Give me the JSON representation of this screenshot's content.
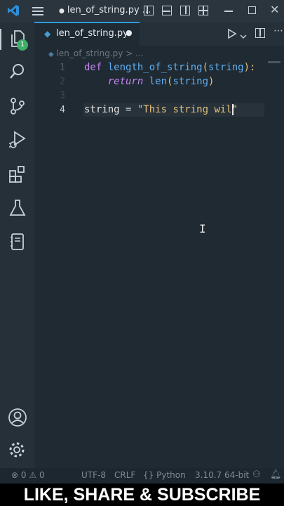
{
  "window": {
    "title": "len_of_string.py ...",
    "modified_indicator": "●"
  },
  "activity_bar": {
    "explorer_badge": "1",
    "items": [
      "explorer",
      "search",
      "source-control",
      "run-debug",
      "extensions",
      "testing",
      "notebook"
    ],
    "bottom_items": [
      "accounts",
      "manage"
    ]
  },
  "tab": {
    "label": "len_of_string.py",
    "dirty_dot": "●"
  },
  "breadcrumb": {
    "file": "len_of_string.py",
    "separator": ">",
    "more": "..."
  },
  "editor": {
    "lines": [
      {
        "number": "1",
        "tokens": {
          "def": "def",
          "name": "length_of_string",
          "open": "(",
          "param": "string",
          "close": "):"
        }
      },
      {
        "number": "2",
        "tokens": {
          "indent": "    ",
          "ret": "return",
          "fn": "len",
          "open": "(",
          "arg": "string",
          "close": ")"
        }
      },
      {
        "number": "3",
        "tokens": {}
      },
      {
        "number": "4",
        "tokens": {
          "var": "string",
          "eq": " = ",
          "str": "\"This string wil",
          "close_quote": "\""
        }
      }
    ]
  },
  "status": {
    "errors": "0",
    "warnings": "0",
    "encoding": "UTF-8",
    "eol": "CRLF",
    "language": "Python",
    "interpreter": "3.10.7 64-bit"
  },
  "banner": {
    "text": "LIKE, SHARE & SUBSCRIBE"
  },
  "colors": {
    "accent": "#2e9cdb",
    "vscode_blue": "#2f8ed8",
    "keyword": "#c586f0",
    "function": "#61afef",
    "string": "#e5c07b",
    "badge": "#3fae6a"
  }
}
